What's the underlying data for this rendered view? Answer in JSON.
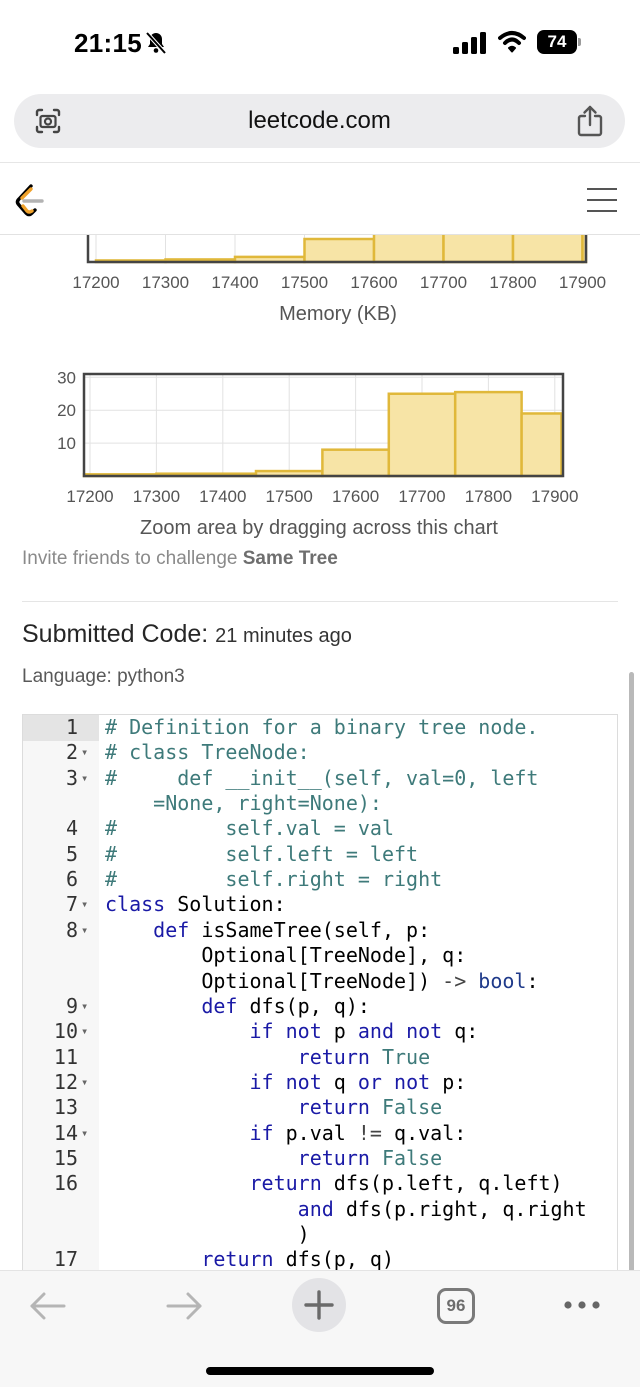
{
  "status_bar": {
    "time": "21:15",
    "battery": "74",
    "icons": [
      "bell-slash-icon",
      "signal-icon",
      "wifi-icon",
      "battery-icon"
    ]
  },
  "browser": {
    "url": "leetcode.com",
    "icons": [
      "camera-search-icon",
      "share-icon"
    ]
  },
  "site_nav": {
    "icons": [
      "leetcode-logo-icon",
      "hamburger-menu-icon"
    ]
  },
  "chart_data": [
    {
      "type": "bar",
      "title": "",
      "xlabel": "Memory (KB)",
      "ylabel": "",
      "x_ticks": [
        "17200",
        "17300",
        "17400",
        "17500",
        "17600",
        "17700",
        "17800",
        "17900"
      ],
      "bins": [
        {
          "x0": 17200,
          "x1": 17300,
          "value": 0.3
        },
        {
          "x0": 17300,
          "x1": 17400,
          "value": 0.5
        },
        {
          "x0": 17400,
          "x1": 17500,
          "value": 1
        },
        {
          "x0": 17500,
          "x1": 17600,
          "value": 4.5
        },
        {
          "x0": 17600,
          "x1": 17700,
          "value": 9
        },
        {
          "x0": 17700,
          "x1": 17800,
          "value": 9
        },
        {
          "x0": 17800,
          "x1": 17900,
          "value": 9
        },
        {
          "x0": 17900,
          "x1": 17950,
          "value": 9
        }
      ],
      "ylim": [
        0,
        9
      ],
      "grid": true,
      "color": "#f7e4a6",
      "edge_color": "#e0b83a"
    },
    {
      "type": "bar",
      "title": "",
      "xlabel": "Zoom area by dragging across this chart",
      "ylabel": "",
      "x_ticks": [
        "17200",
        "17300",
        "17400",
        "17500",
        "17600",
        "17700",
        "17800",
        "17900"
      ],
      "y_ticks": [
        "10",
        "20",
        "30"
      ],
      "bins": [
        {
          "x0": 17150,
          "x1": 17300,
          "value": 0.5
        },
        {
          "x0": 17300,
          "x1": 17450,
          "value": 0.7
        },
        {
          "x0": 17450,
          "x1": 17550,
          "value": 1.5
        },
        {
          "x0": 17550,
          "x1": 17650,
          "value": 8
        },
        {
          "x0": 17650,
          "x1": 17750,
          "value": 25
        },
        {
          "x0": 17750,
          "x1": 17850,
          "value": 25.5
        },
        {
          "x0": 17850,
          "x1": 17910,
          "value": 19
        }
      ],
      "xlim": [
        17150,
        17910
      ],
      "ylim": [
        0,
        31
      ],
      "grid": true,
      "color": "#f7e4a6",
      "edge_color": "#e0b83a"
    }
  ],
  "invite": {
    "prefix": "Invite friends to challenge ",
    "problem": "Same Tree"
  },
  "submission": {
    "heading": "Submitted Code:",
    "time": "21 minutes ago",
    "language": "Language: python3"
  },
  "code_lines": [
    {
      "n": "1",
      "fold": false,
      "tokens": [
        {
          "t": "# Definition for a binary tree node.",
          "c": "c"
        }
      ]
    },
    {
      "n": "2",
      "fold": true,
      "tokens": [
        {
          "t": "# class TreeNode:",
          "c": "c"
        }
      ]
    },
    {
      "n": "3",
      "fold": true,
      "tokens": [
        {
          "t": "#     def __init__(self, val=0, left",
          "c": "c"
        }
      ]
    },
    {
      "n": "",
      "fold": false,
      "tokens": [
        {
          "t": "    =None, right=None):",
          "c": "c"
        }
      ]
    },
    {
      "n": "4",
      "fold": false,
      "tokens": [
        {
          "t": "#         self.val = val",
          "c": "c"
        }
      ]
    },
    {
      "n": "5",
      "fold": false,
      "tokens": [
        {
          "t": "#         self.left = left",
          "c": "c"
        }
      ]
    },
    {
      "n": "6",
      "fold": false,
      "tokens": [
        {
          "t": "#         self.right = right",
          "c": "c"
        }
      ]
    },
    {
      "n": "7",
      "fold": true,
      "tokens": [
        {
          "t": "class",
          "c": "k"
        },
        {
          "t": " Solution:",
          "c": ""
        }
      ]
    },
    {
      "n": "8",
      "fold": true,
      "tokens": [
        {
          "t": "    ",
          "c": ""
        },
        {
          "t": "def",
          "c": "k"
        },
        {
          "t": " isSameTree(self, p:",
          "c": ""
        }
      ]
    },
    {
      "n": "",
      "fold": false,
      "tokens": [
        {
          "t": "        Optional[TreeNode], q:",
          "c": ""
        }
      ]
    },
    {
      "n": "",
      "fold": false,
      "tokens": [
        {
          "t": "        Optional[TreeNode]) ",
          "c": ""
        },
        {
          "t": "->",
          "c": "op"
        },
        {
          "t": " ",
          "c": ""
        },
        {
          "t": "bool",
          "c": "b"
        },
        {
          "t": ":",
          "c": ""
        }
      ]
    },
    {
      "n": "9",
      "fold": true,
      "tokens": [
        {
          "t": "        ",
          "c": ""
        },
        {
          "t": "def",
          "c": "k"
        },
        {
          "t": " dfs(p, q):",
          "c": ""
        }
      ]
    },
    {
      "n": "10",
      "fold": true,
      "tokens": [
        {
          "t": "            ",
          "c": ""
        },
        {
          "t": "if",
          "c": "k"
        },
        {
          "t": " ",
          "c": ""
        },
        {
          "t": "not",
          "c": "k"
        },
        {
          "t": " p ",
          "c": ""
        },
        {
          "t": "and",
          "c": "k"
        },
        {
          "t": " ",
          "c": ""
        },
        {
          "t": "not",
          "c": "k"
        },
        {
          "t": " q:",
          "c": ""
        }
      ]
    },
    {
      "n": "11",
      "fold": false,
      "tokens": [
        {
          "t": "                ",
          "c": ""
        },
        {
          "t": "return",
          "c": "k"
        },
        {
          "t": " ",
          "c": ""
        },
        {
          "t": "True",
          "c": "c"
        }
      ]
    },
    {
      "n": "12",
      "fold": true,
      "tokens": [
        {
          "t": "            ",
          "c": ""
        },
        {
          "t": "if",
          "c": "k"
        },
        {
          "t": " ",
          "c": ""
        },
        {
          "t": "not",
          "c": "k"
        },
        {
          "t": " q ",
          "c": ""
        },
        {
          "t": "or",
          "c": "k"
        },
        {
          "t": " ",
          "c": ""
        },
        {
          "t": "not",
          "c": "k"
        },
        {
          "t": " p:",
          "c": ""
        }
      ]
    },
    {
      "n": "13",
      "fold": false,
      "tokens": [
        {
          "t": "                ",
          "c": ""
        },
        {
          "t": "return",
          "c": "k"
        },
        {
          "t": " ",
          "c": ""
        },
        {
          "t": "False",
          "c": "c"
        }
      ]
    },
    {
      "n": "14",
      "fold": true,
      "tokens": [
        {
          "t": "            ",
          "c": ""
        },
        {
          "t": "if",
          "c": "k"
        },
        {
          "t": " p.val ",
          "c": ""
        },
        {
          "t": "!=",
          "c": "op"
        },
        {
          "t": " q.val:",
          "c": ""
        }
      ]
    },
    {
      "n": "15",
      "fold": false,
      "tokens": [
        {
          "t": "                ",
          "c": ""
        },
        {
          "t": "return",
          "c": "k"
        },
        {
          "t": " ",
          "c": ""
        },
        {
          "t": "False",
          "c": "c"
        }
      ]
    },
    {
      "n": "16",
      "fold": false,
      "tokens": [
        {
          "t": "            ",
          "c": ""
        },
        {
          "t": "return",
          "c": "k"
        },
        {
          "t": " dfs(p.left, q.left)",
          "c": ""
        }
      ]
    },
    {
      "n": "",
      "fold": false,
      "tokens": [
        {
          "t": "                ",
          "c": ""
        },
        {
          "t": "and",
          "c": "k"
        },
        {
          "t": " dfs(p.right, q.right",
          "c": ""
        }
      ]
    },
    {
      "n": "",
      "fold": false,
      "tokens": [
        {
          "t": "                )",
          "c": ""
        }
      ]
    },
    {
      "n": "17",
      "fold": false,
      "tokens": [
        {
          "t": "        ",
          "c": ""
        },
        {
          "t": "return",
          "c": "k"
        },
        {
          "t": " dfs(p, q)",
          "c": ""
        }
      ]
    }
  ],
  "toolbar": {
    "tabs_count": "96",
    "icons": [
      "back-arrow-icon",
      "forward-arrow-icon",
      "plus-icon",
      "tabs-icon",
      "more-icon"
    ]
  },
  "colors": {
    "accent": "#f7e4a6",
    "keyword": "#1a1aa6",
    "comment": "#3e7a7a"
  }
}
